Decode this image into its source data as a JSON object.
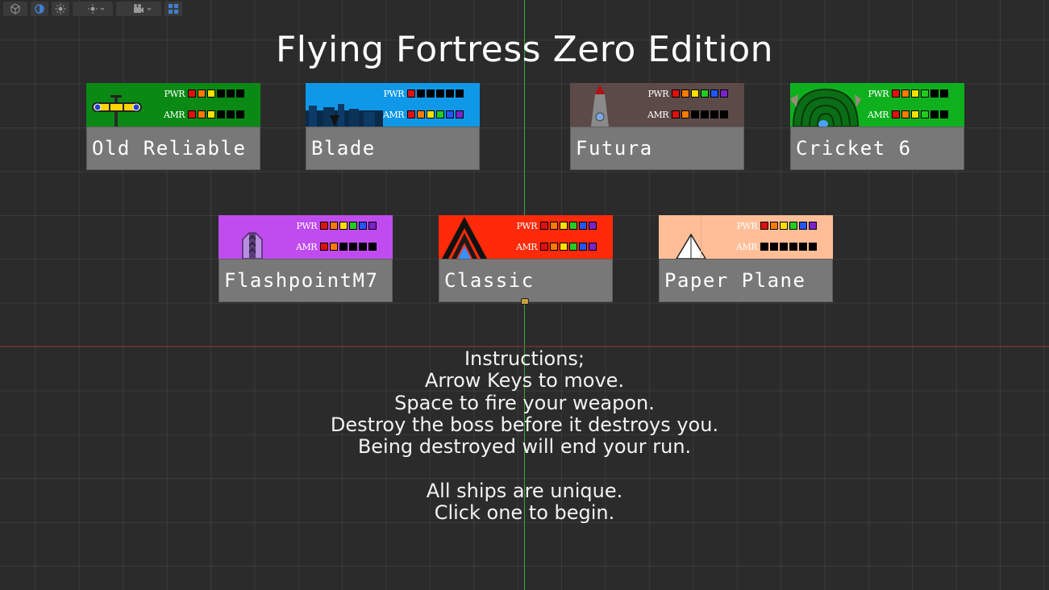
{
  "title": "Flying Fortress Zero Edition",
  "stat_labels": {
    "power": "PWR",
    "armor": "AMR"
  },
  "pip_colors": [
    "#e01010",
    "#ff7a00",
    "#ffe000",
    "#22cc22",
    "#2255ff",
    "#7a22cc"
  ],
  "empty_pip_color": "#000000",
  "ships": [
    {
      "name": "Old Reliable",
      "banner_color": "#0a8a14",
      "power": 3,
      "armor": 3
    },
    {
      "name": "Blade",
      "banner_color": "#1098e8",
      "power": 1,
      "armor": 6
    },
    {
      "name": "Futura",
      "banner_color": "#5c4a48",
      "power": 6,
      "armor": 2
    },
    {
      "name": "Cricket 6",
      "banner_color": "#0fb01e",
      "power": 4,
      "armor": 4
    },
    {
      "name": "FlashpointM7",
      "banner_color": "#c04cf0",
      "power": 6,
      "armor": 2
    },
    {
      "name": "Classic",
      "banner_color": "#ff2a0a",
      "power": 6,
      "armor": 6
    },
    {
      "name": "Paper Plane",
      "banner_color": "#ffbe98",
      "power": 6,
      "armor": 0
    }
  ],
  "instructions": [
    "Instructions;",
    "Arrow Keys to move.",
    "Space to fire your weapon.",
    "Destroy the boss before it destroys you.",
    "Being destroyed will end your run.",
    "",
    "All ships are unique.",
    "Click one to begin."
  ]
}
